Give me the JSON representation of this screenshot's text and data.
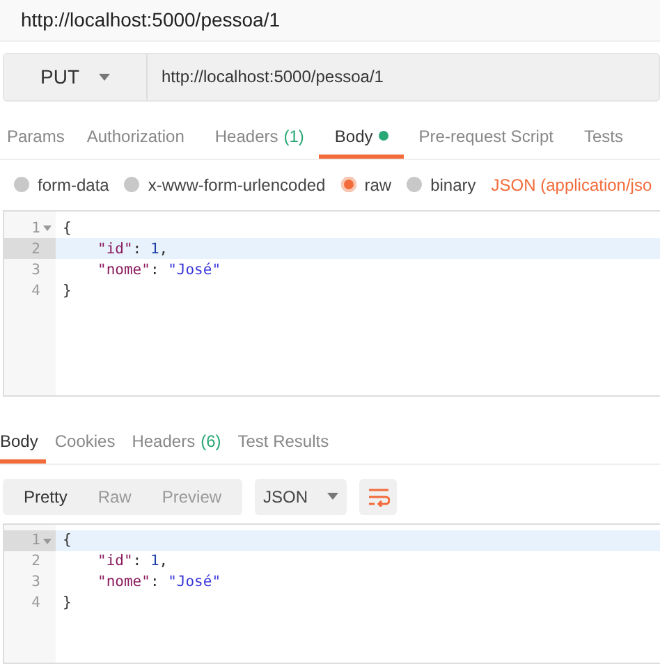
{
  "title": "http://localhost:5000/pessoa/1",
  "request": {
    "method": "PUT",
    "url": "http://localhost:5000/pessoa/1"
  },
  "request_tabs": [
    {
      "label": "Params",
      "selected": false
    },
    {
      "label": "Authorization",
      "selected": false
    },
    {
      "label": "Headers",
      "count": "(1)",
      "selected": false
    },
    {
      "label": "Body",
      "dot": true,
      "selected": true
    },
    {
      "label": "Pre-request Script",
      "selected": false
    },
    {
      "label": "Tests",
      "selected": false
    }
  ],
  "body_types": [
    {
      "label": "form-data",
      "selected": false
    },
    {
      "label": "x-www-form-urlencoded",
      "selected": false
    },
    {
      "label": "raw",
      "selected": true
    },
    {
      "label": "binary",
      "selected": false
    }
  ],
  "content_type": "JSON (application/jso",
  "request_editor": [
    {
      "number": "1",
      "foldable": true,
      "highlighted": false,
      "indented": false,
      "tokens": [
        {
          "kind": "punct",
          "text": "{"
        }
      ]
    },
    {
      "number": "2",
      "foldable": false,
      "highlighted": true,
      "indented": true,
      "tokens": [
        {
          "kind": "key",
          "text": "\"id\""
        },
        {
          "kind": "punct",
          "text": ": "
        },
        {
          "kind": "number",
          "text": "1"
        },
        {
          "kind": "punct",
          "text": ","
        }
      ]
    },
    {
      "number": "3",
      "foldable": false,
      "highlighted": false,
      "indented": true,
      "tokens": [
        {
          "kind": "key",
          "text": "\"nome\""
        },
        {
          "kind": "punct",
          "text": ": "
        },
        {
          "kind": "string",
          "text": "\"José\""
        }
      ]
    },
    {
      "number": "4",
      "foldable": false,
      "highlighted": false,
      "indented": false,
      "tokens": [
        {
          "kind": "punct",
          "text": "}"
        }
      ]
    }
  ],
  "response_tabs": [
    {
      "label": "Body",
      "selected": true
    },
    {
      "label": "Cookies",
      "selected": false
    },
    {
      "label": "Headers",
      "count": "(6)",
      "selected": false
    },
    {
      "label": "Test Results",
      "selected": false
    }
  ],
  "view_modes": [
    {
      "label": "Pretty",
      "selected": true
    },
    {
      "label": "Raw",
      "selected": false
    },
    {
      "label": "Preview",
      "selected": false
    }
  ],
  "format": "JSON",
  "response_editor": [
    {
      "number": "1",
      "foldable": true,
      "highlighted": true,
      "indented": false,
      "tokens": [
        {
          "kind": "punct",
          "text": "{"
        }
      ]
    },
    {
      "number": "2",
      "foldable": false,
      "highlighted": false,
      "indented": true,
      "tokens": [
        {
          "kind": "key",
          "text": "\"id\""
        },
        {
          "kind": "punct",
          "text": ": "
        },
        {
          "kind": "number",
          "text": "1"
        },
        {
          "kind": "punct",
          "text": ","
        }
      ]
    },
    {
      "number": "3",
      "foldable": false,
      "highlighted": false,
      "indented": true,
      "tokens": [
        {
          "kind": "key",
          "text": "\"nome\""
        },
        {
          "kind": "punct",
          "text": ": "
        },
        {
          "kind": "string",
          "text": "\"José\""
        }
      ]
    },
    {
      "number": "4",
      "foldable": false,
      "highlighted": false,
      "indented": false,
      "tokens": [
        {
          "kind": "punct",
          "text": "}"
        }
      ]
    }
  ]
}
